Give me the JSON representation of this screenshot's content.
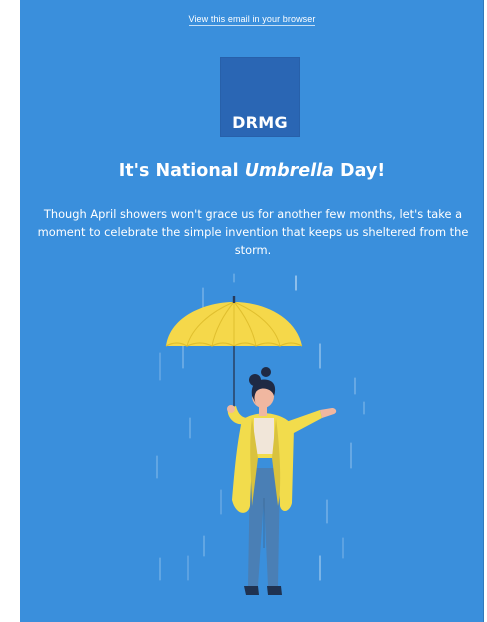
{
  "header": {
    "browser_link": "View this email in your browser"
  },
  "logo": {
    "text": "DRMG"
  },
  "hero": {
    "title_prefix": "It's National ",
    "title_emphasis": "Umbrella",
    "title_suffix": " Day!",
    "body": "Though April showers won't grace us for another few months, let's take a moment to celebrate the simple invention that keeps us sheltered from the storm."
  },
  "illustration": {
    "subject": "woman-with-yellow-umbrella-in-rain",
    "icon": "umbrella-illustration"
  },
  "colors": {
    "background": "#3a8fdc",
    "logo_bg": "#2a66b4",
    "umbrella": "#f5d84a",
    "raincoat": "#f2dc4c",
    "jeans": "#4a7fb5"
  }
}
